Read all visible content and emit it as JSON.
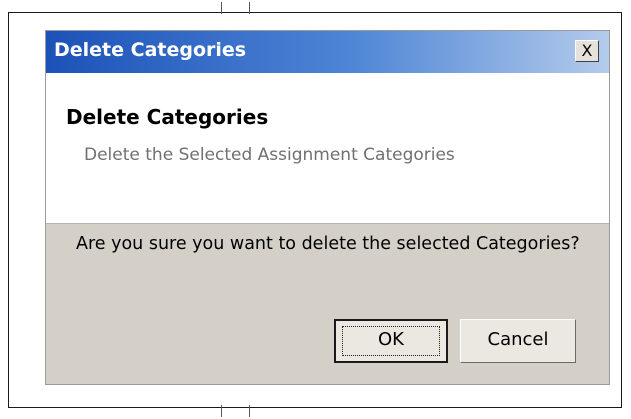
{
  "dialog": {
    "title": "Delete Categories",
    "close_label": "X",
    "header": {
      "title": "Delete Categories",
      "subtitle": "Delete the Selected Assignment Categories"
    },
    "message": "Are you sure you want to delete the selected Categories?",
    "buttons": {
      "ok_label": "OK",
      "cancel_label": "Cancel"
    },
    "colors": {
      "titlebar_start": "#1c52b8",
      "titlebar_end": "#b4cbeb",
      "body_background": "#d4d0c8",
      "header_background": "#ffffff"
    }
  }
}
